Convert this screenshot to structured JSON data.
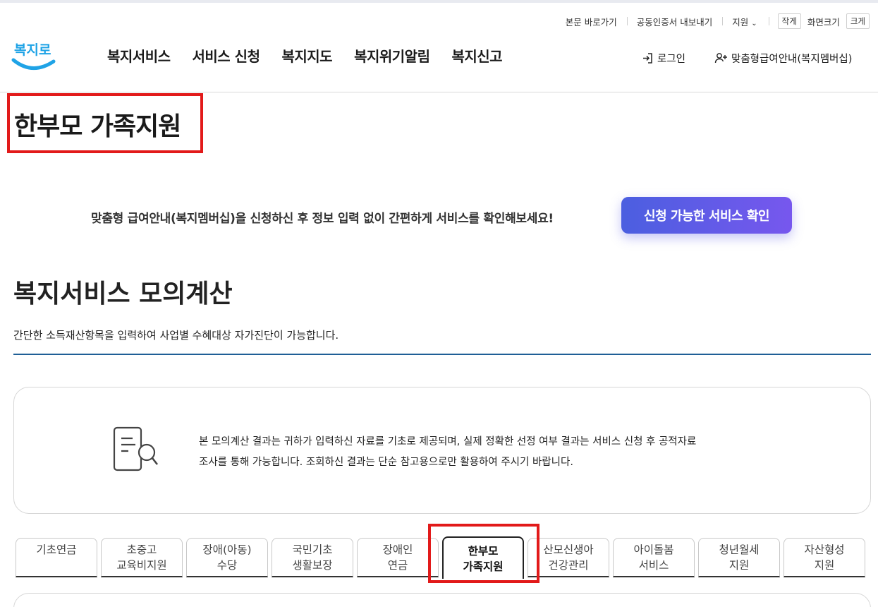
{
  "utility": {
    "skip_link": "본문 바로가기",
    "cert_export": "공동인증서 내보내기",
    "support": "지원",
    "font_small": "작게",
    "font_label": "화면크기",
    "font_large": "크게"
  },
  "logo": {
    "text": "복지로"
  },
  "gnb": [
    "복지서비스",
    "서비스 신청",
    "복지지도",
    "복지위기알림",
    "복지신고"
  ],
  "header": {
    "login": "로그인",
    "membership": "맞춤형급여안내(복지멤버십)"
  },
  "page_title": "한부모 가족지원",
  "banner": {
    "text": "맞춤형 급여안내(복지멤버십)을 신청하신 후 정보 입력 없이 간편하게 서비스를 확인해보세요!",
    "button": "신청 가능한 서비스 확인"
  },
  "section": {
    "title": "복지서비스 모의계산",
    "desc": "간단한 소득재산항목을 입력하여 사업별 수혜대상 자가진단이 가능합니다."
  },
  "notice": {
    "line1": "본 모의계산 결과는 귀하가 입력하신 자료를 기초로 제공되며, 실제 정확한 선정 여부 결과는 서비스 신청 후 공적자료",
    "line2": "조사를 통해 가능합니다. 조회하신 결과는 단순 참고용으로만 활용하여 주시기 바랍니다."
  },
  "tabs": [
    {
      "l1": "기초연금",
      "l2": ""
    },
    {
      "l1": "초중고",
      "l2": "교육비지원"
    },
    {
      "l1": "장애(아동)",
      "l2": "수당"
    },
    {
      "l1": "국민기초",
      "l2": "생활보장"
    },
    {
      "l1": "장애인",
      "l2": "연금"
    },
    {
      "l1": "한부모",
      "l2": "가족지원"
    },
    {
      "l1": "산모신생아",
      "l2": "건강관리"
    },
    {
      "l1": "아이돌봄",
      "l2": "서비스"
    },
    {
      "l1": "청년월세",
      "l2": "지원"
    },
    {
      "l1": "자산형성",
      "l2": "지원"
    }
  ],
  "active_tab": "한부모 가족지원",
  "colors": {
    "highlight": "#e21a1a",
    "accent_blue": "#1f5f96",
    "button_start": "#4b5fe0",
    "button_end": "#7757ee",
    "logo_blue": "#1fa3e6"
  }
}
